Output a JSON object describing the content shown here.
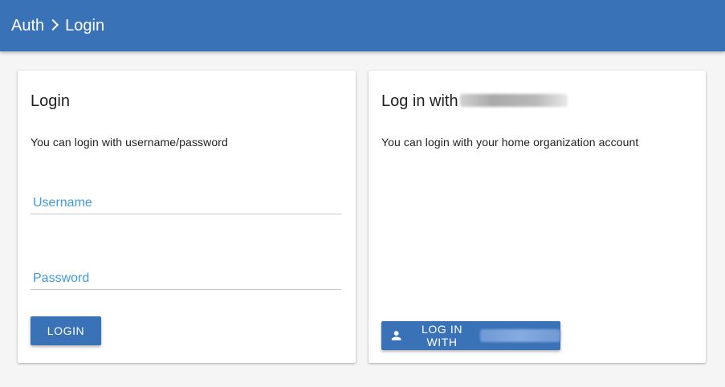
{
  "breadcrumb": {
    "parent": "Auth",
    "current": "Login"
  },
  "login_card": {
    "title": "Login",
    "description": "You can login with username/password",
    "username_placeholder": "Username",
    "password_placeholder": "Password",
    "submit_label": "LOGIN"
  },
  "org_card": {
    "title": "Log in with",
    "description": "You can login with your home organization account",
    "button_label": "LOG IN WITH",
    "button_icon": "person-icon"
  },
  "colors": {
    "primary": "#3a72b8",
    "field_label": "#3f9ae0",
    "background": "#f5f5f5"
  }
}
